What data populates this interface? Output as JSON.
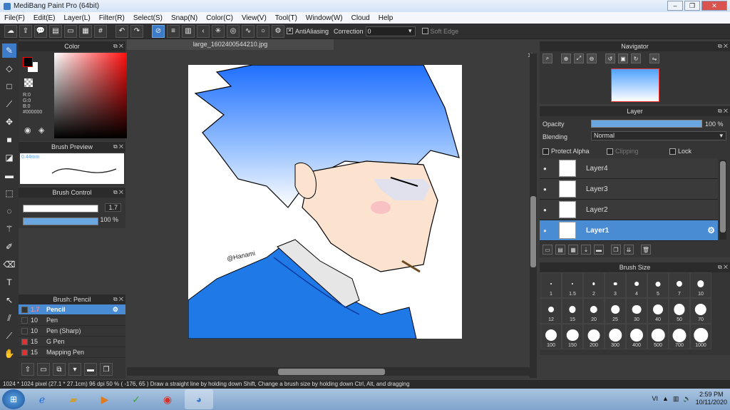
{
  "window": {
    "title": "MediBang Paint Pro (64bit)",
    "minimize": "–",
    "restore": "❐",
    "close": "✕"
  },
  "menu": [
    "File(F)",
    "Edit(E)",
    "Layer(L)",
    "Filter(R)",
    "Select(S)",
    "Snap(N)",
    "Color(C)",
    "View(V)",
    "Tool(T)",
    "Window(W)",
    "Cloud",
    "Help"
  ],
  "toolbar": {
    "antialiasing": "AntiAliasing",
    "correction_label": "Correction",
    "correction_value": "0",
    "soft_edge": "Soft Edge"
  },
  "color_panel": {
    "title": "Color",
    "r": "R:0",
    "g": "G:0",
    "b": "B:0",
    "hex": "#000000"
  },
  "brush_preview": {
    "title": "Brush Preview",
    "size": "0.44mm"
  },
  "brush_control": {
    "title": "Brush Control",
    "size": "1.7",
    "opacity": "100 %"
  },
  "brush_list": {
    "title": "Brush: Pencil",
    "items": [
      {
        "size": "1.7",
        "name": "Pencil",
        "color": "#333333",
        "selected": true
      },
      {
        "size": "10",
        "name": "Pen",
        "color": "#333333"
      },
      {
        "size": "10",
        "name": "Pen (Sharp)",
        "color": "#333333"
      },
      {
        "size": "15",
        "name": "G Pen",
        "color": "#e03030"
      },
      {
        "size": "15",
        "name": "Mapping Pen",
        "color": "#e03030"
      }
    ]
  },
  "document": {
    "tab": "large_1602400544210.jpg",
    "signature": "@Hanami"
  },
  "navigator": {
    "title": "Navigator"
  },
  "layer_panel": {
    "title": "Layer",
    "opacity_label": "Opacity",
    "opacity_value": "100 %",
    "blending_label": "Blending",
    "blending_value": "Normal",
    "protect_alpha": "Protect Alpha",
    "clipping": "Clipping",
    "lock": "Lock",
    "layers": [
      "Layer4",
      "Layer3",
      "Layer2",
      "Layer1"
    ]
  },
  "brush_size": {
    "title": "Brush Size",
    "sizes": [
      "1",
      "1.5",
      "2",
      "3",
      "4",
      "5",
      "7",
      "10",
      "12",
      "15",
      "20",
      "25",
      "30",
      "40",
      "50",
      "70",
      "100",
      "150",
      "200",
      "300",
      "400",
      "500",
      "700",
      "1000"
    ]
  },
  "status": "1024 * 1024 pixel  (27.1 * 27.1cm)  96 dpi  50 %  ( -176, 65 )  Draw a straight line by holding down Shift, Change a brush size by holding down Ctrl, Alt, and dragging",
  "taskbar": {
    "lang": "VI",
    "time": "2:59 PM",
    "date": "10/11/2020"
  }
}
